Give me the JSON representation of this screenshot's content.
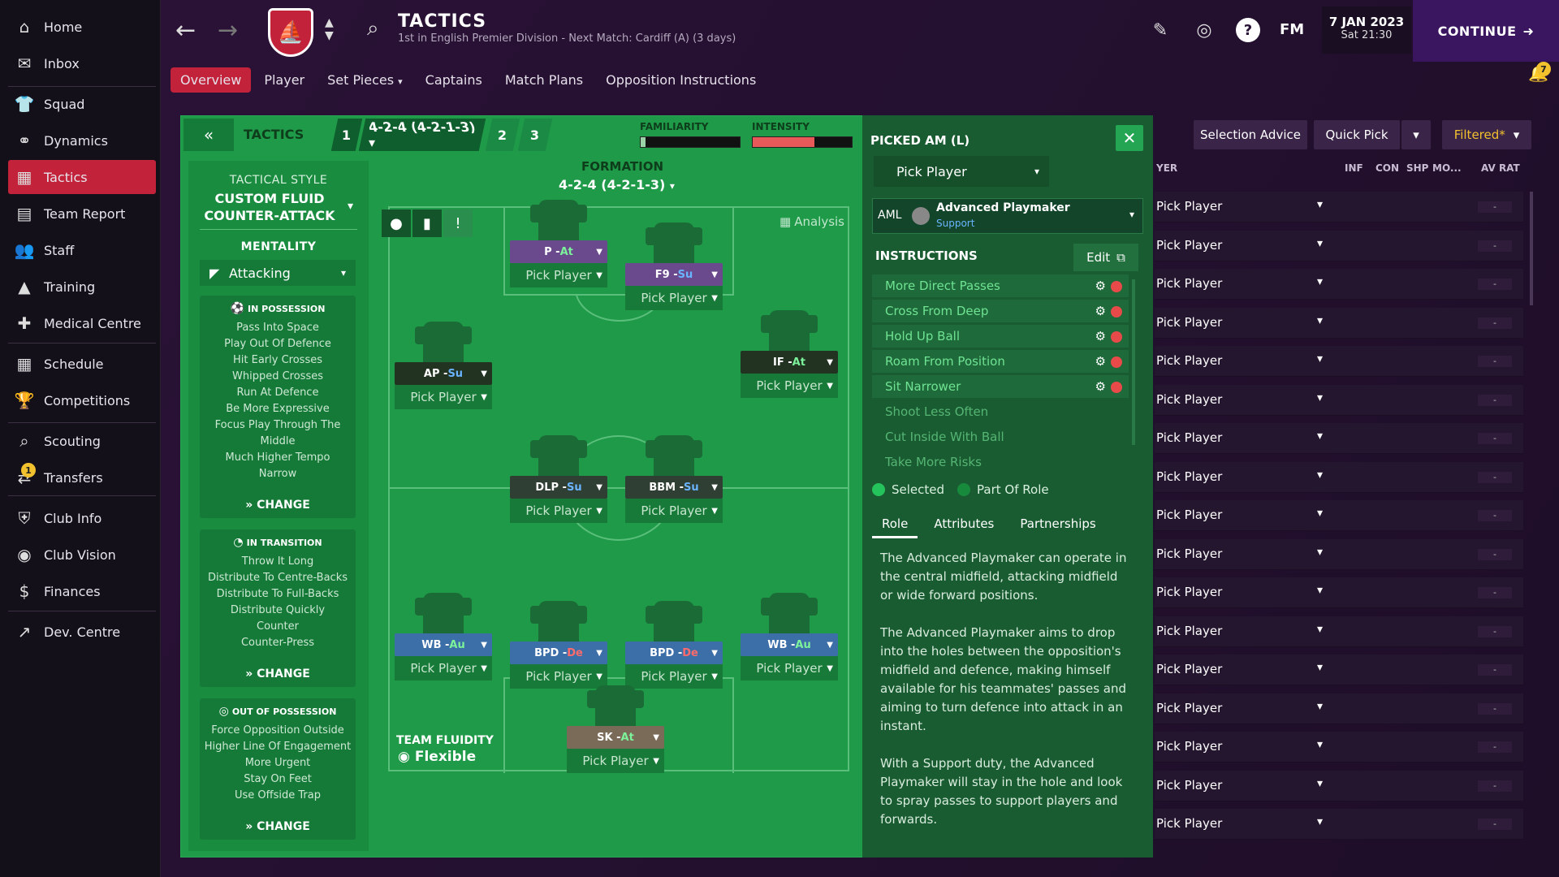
{
  "sidebar": {
    "items": [
      {
        "label": "Home",
        "icon": "home-icon"
      },
      {
        "label": "Inbox",
        "icon": "inbox-icon"
      },
      {
        "label": "Squad",
        "icon": "squad-icon"
      },
      {
        "label": "Dynamics",
        "icon": "dynamics-icon"
      },
      {
        "label": "Tactics",
        "icon": "tactics-icon"
      },
      {
        "label": "Team Report",
        "icon": "report-icon"
      },
      {
        "label": "Staff",
        "icon": "staff-icon"
      },
      {
        "label": "Training",
        "icon": "training-icon"
      },
      {
        "label": "Medical Centre",
        "icon": "medical-icon"
      },
      {
        "label": "Schedule",
        "icon": "calendar-icon"
      },
      {
        "label": "Competitions",
        "icon": "trophy-icon"
      },
      {
        "label": "Scouting",
        "icon": "search-icon"
      },
      {
        "label": "Transfers",
        "icon": "transfers-icon"
      },
      {
        "label": "Club Info",
        "icon": "shield-icon"
      },
      {
        "label": "Club Vision",
        "icon": "vision-icon"
      },
      {
        "label": "Finances",
        "icon": "finances-icon"
      },
      {
        "label": "Dev. Centre",
        "icon": "dev-icon"
      }
    ],
    "transfers_badge": "1"
  },
  "header": {
    "title": "TACTICS",
    "subtitle": "1st in English Premier Division - Next Match: Cardiff (A) (3 days)",
    "fm": "FM",
    "date": "7 JAN 2023",
    "time": "Sat 21:30",
    "continue": "CONTINUE",
    "notifications": "7",
    "help": "?"
  },
  "tabs": [
    "Overview",
    "Player",
    "Set Pieces",
    "Captains",
    "Match Plans",
    "Opposition Instructions"
  ],
  "topbar": {
    "tactics_label": "TACTICS",
    "slot1": "1",
    "slot1_formation": "4-2-4 (4-2-1-3)",
    "slot2": "2",
    "slot3": "3",
    "familiarity_label": "FAMILIARITY",
    "intensity_label": "INTENSITY",
    "familiarity_level": 0.05,
    "intensity_level": 0.62
  },
  "left": {
    "style_label": "TACTICAL STYLE",
    "style_name_1": "CUSTOM FLUID",
    "style_name_2": "COUNTER-ATTACK",
    "mentality_label": "MENTALITY",
    "mentality": "Attacking",
    "in_possession": {
      "title": "IN POSSESSION",
      "items": [
        "Pass Into Space",
        "Play Out Of Defence",
        "Hit Early Crosses",
        "Whipped Crosses",
        "Run At Defence",
        "Be More Expressive",
        "Focus Play Through The",
        "Middle",
        "Much Higher Tempo",
        "Narrow"
      ],
      "change": "CHANGE"
    },
    "in_transition": {
      "title": "IN TRANSITION",
      "items": [
        "Throw It Long",
        "Distribute To Centre-Backs",
        "Distribute To Full-Backs",
        "Distribute Quickly",
        "Counter",
        "Counter-Press"
      ],
      "change": "CHANGE"
    },
    "out_of_possession": {
      "title": "OUT OF POSSESSION",
      "items": [
        "Force Opposition Outside",
        "Higher Line Of Engagement",
        "More Urgent",
        "Stay On Feet",
        "Use Offside Trap"
      ],
      "change": "CHANGE"
    }
  },
  "pitch": {
    "formation_label": "FORMATION",
    "formation": "4-2-4 (4-2-1-3)",
    "analysis": "Analysis",
    "fluidity_label": "TEAM FLUIDITY",
    "fluidity": "Flexible",
    "pick_label": "Pick Player",
    "players": [
      {
        "role": "P",
        "duty": "At",
        "color": "#6a4a8c",
        "duty_color": "#7cf29a"
      },
      {
        "role": "F9",
        "duty": "Su",
        "color": "#6a4a8c",
        "duty_color": "#6ab4ff"
      },
      {
        "role": "AP",
        "duty": "Su",
        "color": "#223322",
        "duty_color": "#6ab4ff"
      },
      {
        "role": "IF",
        "duty": "At",
        "color": "#223322",
        "duty_color": "#7cf29a"
      },
      {
        "role": "DLP",
        "duty": "Su",
        "color": "#2f3f33",
        "duty_color": "#6ab4ff"
      },
      {
        "role": "BBM",
        "duty": "Su",
        "color": "#2f3f33",
        "duty_color": "#6ab4ff"
      },
      {
        "role": "WB",
        "duty": "Au",
        "color": "#3c6ea8",
        "duty_color": "#7cf29a"
      },
      {
        "role": "BPD",
        "duty": "De",
        "color": "#3c6ea8",
        "duty_color": "#ff6b6b"
      },
      {
        "role": "BPD",
        "duty": "De",
        "color": "#3c6ea8",
        "duty_color": "#ff6b6b"
      },
      {
        "role": "WB",
        "duty": "Au",
        "color": "#3c6ea8",
        "duty_color": "#7cf29a"
      },
      {
        "role": "SK",
        "duty": "At",
        "color": "#7a6a58",
        "duty_color": "#7cf29a"
      }
    ]
  },
  "detail": {
    "title": "PICKED AM (L)",
    "pick": "Pick Player",
    "position": "AML",
    "role_name": "Advanced Playmaker",
    "role_duty": "Support",
    "instructions_label": "INSTRUCTIONS",
    "edit": "Edit",
    "instructions": [
      {
        "label": "More Direct Passes",
        "selected": true
      },
      {
        "label": "Cross From Deep",
        "selected": true
      },
      {
        "label": "Hold Up Ball",
        "selected": true
      },
      {
        "label": "Roam From Position",
        "selected": true
      },
      {
        "label": "Sit Narrower",
        "selected": true
      },
      {
        "label": "Shoot Less Often",
        "selected": false
      },
      {
        "label": "Cut Inside With Ball",
        "selected": false
      },
      {
        "label": "Take More Risks",
        "selected": false
      }
    ],
    "legend_selected": "Selected",
    "legend_part": "Part Of Role",
    "tabs": [
      "Role",
      "Attributes",
      "Partnerships"
    ],
    "desc": [
      "The Advanced Playmaker can operate in the central midfield, attacking midfield or wide forward positions.",
      "The Advanced Playmaker aims to drop into the holes between the opposition's midfield and defence, making himself available for his teammates' passes and aiming to turn defence into attack in an instant.",
      "With a Support duty, the Advanced Playmaker will stay in the hole and look to spray passes to support players and forwards."
    ]
  },
  "list": {
    "selection_advice": "Selection Advice",
    "quick_pick": "Quick Pick",
    "filtered": "Filtered*",
    "headers": {
      "player": "YER",
      "inf": "INF",
      "con": "CON",
      "shp": "SHP",
      "mo": "MO...",
      "avrat": "AV RAT"
    },
    "row_label": "Pick Player",
    "row_rating": "-",
    "rows": 17
  }
}
